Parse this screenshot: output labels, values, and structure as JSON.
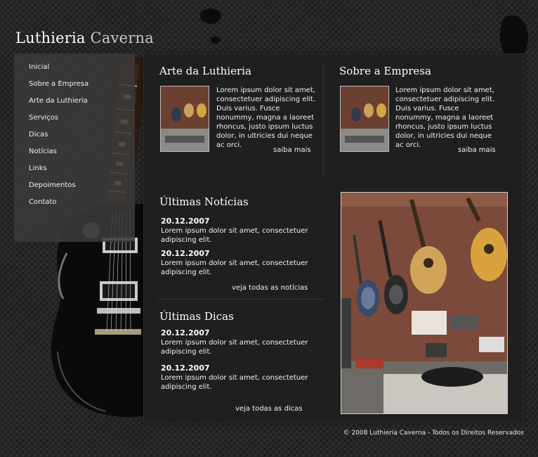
{
  "site": {
    "name_part1": "Luthieria",
    "name_part2": "Caverna"
  },
  "nav": {
    "items": [
      "Inicial",
      "Sobre a Empresa",
      "Arte da Luthieria",
      "Serviços",
      "Dicas",
      "Notícias",
      "Links",
      "Depoimentos",
      "Contato"
    ]
  },
  "arte": {
    "title": "Arte da Luthieria",
    "text": "Lorem ipsum dolor sit amet, consectetuer adipiscing elit. Duis varius. Fusce nonummy, magna a laoreet rhoncus, justo ipsum luctus dolor, in ultricies dui neque ac orci.",
    "more": "saiba mais"
  },
  "sobre": {
    "title": "Sobre a Empresa",
    "text": "Lorem ipsum dolor sit amet, consectetuer adipiscing elit. Duis varius. Fusce nonummy, magna a laoreet rhoncus, justo ipsum luctus dolor, in ultricies dui neque ac orci.",
    "more": "saiba mais"
  },
  "noticias": {
    "title": "Últimas Notícias",
    "items": [
      {
        "date": "20.12.2007",
        "text": "Lorem ipsum dolor sit amet, consectetuer adipiscing elit."
      },
      {
        "date": "20.12.2007",
        "text": "Lorem ipsum dolor sit amet, consectetuer adipiscing elit."
      }
    ],
    "more": "veja todas as notícias"
  },
  "dicas": {
    "title": "Últimas Dicas",
    "items": [
      {
        "date": "20.12.2007",
        "text": "Lorem ipsum dolor sit amet, consectetuer adipiscing elit."
      },
      {
        "date": "20.12.2007",
        "text": "Lorem ipsum dolor sit amet, consectetuer adipiscing elit."
      }
    ],
    "more": "veja todas as dicas"
  },
  "footer": {
    "text": "©  2008 Luthieria Caverna - Todos os Direitos Reservados"
  },
  "colors": {
    "background": "#262626",
    "panel": "#1f1f1f",
    "nav": "#3a3a3a",
    "text": "#ffffff"
  }
}
